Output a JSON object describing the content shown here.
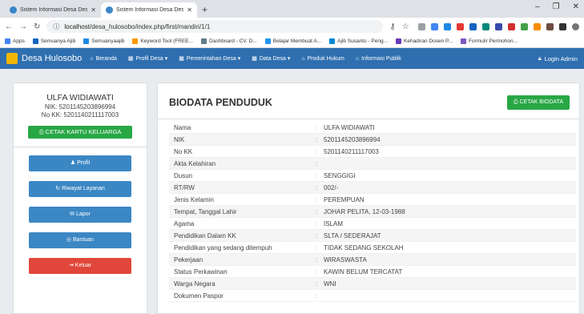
{
  "browser": {
    "tabs": [
      {
        "title": "Sistem Informasi Desa Desa Hulo"
      },
      {
        "title": "Sistem Informasi Desa Desa Hulo"
      }
    ],
    "new_tab": "+",
    "window_controls": [
      "–",
      "❐",
      "✕"
    ],
    "url_host": "localhost",
    "url_path": "/desa_hulosobo/index.php/first/mandiri/1/1",
    "bookmarks": [
      {
        "label": "Apps",
        "color": "#4285f4"
      },
      {
        "label": "Semuanya Ajib",
        "color": "#1565c0"
      },
      {
        "label": "Semuanyaajib",
        "color": "#1e88e5"
      },
      {
        "label": "Keyword Tool (FREE...",
        "color": "#ff9800"
      },
      {
        "label": "Dashboard - CV. D...",
        "color": "#607d8b"
      },
      {
        "label": "Belajar Membuat A...",
        "color": "#2196f3"
      },
      {
        "label": "Ajib Susanto - Peng...",
        "color": "#0288d1"
      },
      {
        "label": "Kehadiran Dosen P...",
        "color": "#673ab7"
      },
      {
        "label": "Formulir Permohon...",
        "color": "#7e57c2"
      }
    ]
  },
  "navbar": {
    "brand": "Desa Hulosobo",
    "items": [
      {
        "label": "Beranda",
        "icon": "⌂"
      },
      {
        "label": "Profil Desa ▾",
        "icon": "▦"
      },
      {
        "label": "Pemerintahan Desa ▾",
        "icon": "▦"
      },
      {
        "label": "Data Desa ▾",
        "icon": "▦"
      },
      {
        "label": "Produk Hukum",
        "icon": "⌂"
      },
      {
        "label": "Informasi Publik",
        "icon": "⌂"
      }
    ],
    "login": "Login Admin"
  },
  "profile": {
    "name": "ULFA WIDIAWATI",
    "nik_line": "NIK: 5201145203896994",
    "kk_line": "No KK: 5201140211117003",
    "btn_kk": "CETAK KARTU KELUARGA",
    "menu": [
      {
        "label": "Profil",
        "icon": "♟",
        "color": "blue"
      },
      {
        "label": "Riwayat Layanan",
        "icon": "↻",
        "color": "blue"
      },
      {
        "label": "Lapor",
        "icon": "✉",
        "color": "blue"
      },
      {
        "label": "Bantuan",
        "icon": "◎",
        "color": "blue"
      },
      {
        "label": "Keluar",
        "icon": "⇥",
        "color": "red"
      }
    ]
  },
  "biodata": {
    "title": "BIODATA PENDUDUK",
    "btn_print": "CETAK BIODATA",
    "rows": [
      {
        "label": "Nama",
        "value": "ULFA WIDIAWATI"
      },
      {
        "label": "NIK",
        "value": "5201145203896994"
      },
      {
        "label": "No KK",
        "value": "5201140211117003"
      },
      {
        "label": "Akta Kelahiran",
        "value": ""
      },
      {
        "label": "Dusun",
        "value": "SENGGIGI"
      },
      {
        "label": "RT/RW",
        "value": "002/-"
      },
      {
        "label": "Jenis Kelamin",
        "value": "PEREMPUAN"
      },
      {
        "label": "Tempat, Tanggal Lahir",
        "value": "JOHAR PELITA, 12-03-1988"
      },
      {
        "label": "Agama",
        "value": "ISLAM"
      },
      {
        "label": "Pendidikan Dalam KK",
        "value": "SLTA / SEDERAJAT"
      },
      {
        "label": "Pendidikan yang sedang ditempuh",
        "value": "TIDAK SEDANG SEKOLAH"
      },
      {
        "label": "Pekerjaan",
        "value": "WIRASWASTA"
      },
      {
        "label": "Status Perkawinan",
        "value": "KAWIN BELUM TERCATAT"
      },
      {
        "label": "Warga Negara",
        "value": "WNI"
      },
      {
        "label": "Dokumen Paspor",
        "value": ""
      }
    ]
  }
}
